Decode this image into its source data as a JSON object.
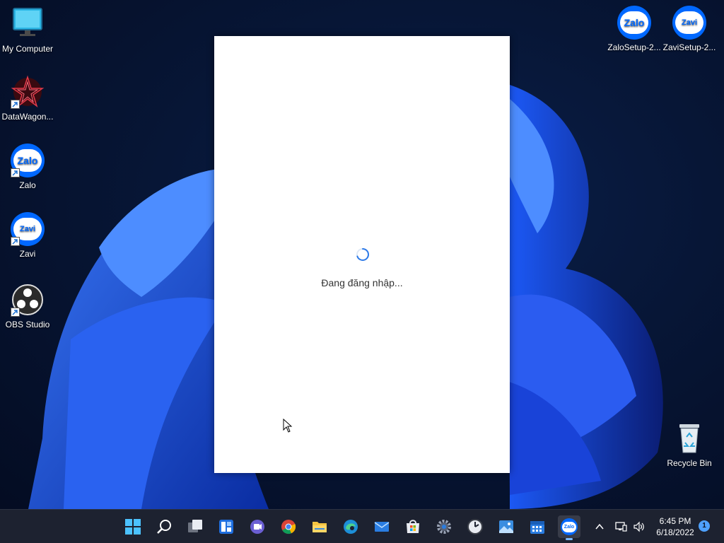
{
  "desktop": {
    "left_icons": [
      {
        "label": "My Computer"
      },
      {
        "label": "DataWagon..."
      },
      {
        "label": "Zalo",
        "glyph": "Zalo"
      },
      {
        "label": "Zavi",
        "glyph": "Zavi"
      },
      {
        "label": "OBS Studio"
      }
    ],
    "right_icons": [
      {
        "label": "ZaloSetup-2...",
        "glyph": "Zalo"
      },
      {
        "label": "ZaviSetup-2...",
        "glyph": "Zavi"
      }
    ],
    "recycle_bin": {
      "label": "Recycle Bin"
    }
  },
  "app_window": {
    "status": "Đang đăng nhập..."
  },
  "taskbar": {
    "icons": [
      "windows-start-icon",
      "search-icon",
      "task-view-icon",
      "widgets-icon",
      "teams-chat-icon",
      "chrome-icon",
      "file-explorer-icon",
      "edge-icon",
      "mail-icon",
      "store-icon",
      "settings-icon",
      "clock-app-icon",
      "photos-icon",
      "calendar-icon",
      "zalo-taskbar-icon"
    ],
    "badge_glyph": "Zalo",
    "clock": {
      "time": "6:45 PM",
      "date": "6/18/2022"
    },
    "notifications": "1"
  },
  "colors": {
    "zalo_blue": "#0068ff",
    "taskbar_bg": "#1d2230",
    "accent": "#4ea1ff"
  }
}
